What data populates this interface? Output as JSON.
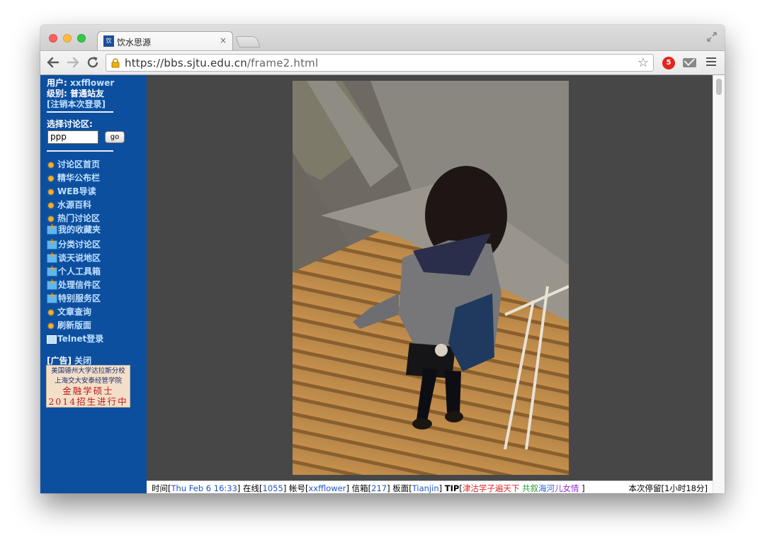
{
  "browser": {
    "tab_title": "饮水思源",
    "tab_favicon_text": "饮水",
    "tab_close": "×",
    "url_prefix": "https://",
    "url_host": "bbs.sjtu.edu.cn",
    "url_path": "/frame2.html",
    "ext_badge": "5"
  },
  "sidebar": {
    "user_label": "用户:",
    "user_value": "xxfflower",
    "level_label": "级别:",
    "level_value": "普通站友",
    "logout": "[注销本次登录]",
    "select_board_label": "选择讨论区:",
    "board_input_value": "ppp",
    "go_label": "go",
    "menu": [
      {
        "label": "讨论区首页",
        "icon": "gear-icon"
      },
      {
        "label": "精华公布栏",
        "icon": "gear-icon"
      },
      {
        "label": "WEB导读",
        "icon": "gear-icon"
      },
      {
        "label": "水源百科",
        "icon": "gear-icon"
      },
      {
        "label": "热门讨论区",
        "icon": "gear-icon"
      },
      {
        "label": "我的收藏夹",
        "icon": "folder-icon"
      },
      {
        "label": "分类讨论区",
        "icon": "folder-icon"
      },
      {
        "label": "谈天说地区",
        "icon": "folder-icon"
      },
      {
        "label": "个人工具箱",
        "icon": "folder-icon"
      },
      {
        "label": "处理信件区",
        "icon": "folder-icon"
      },
      {
        "label": "特别服务区",
        "icon": "folder-icon"
      },
      {
        "label": "文章查询",
        "icon": "gear-icon"
      },
      {
        "label": "刷新版面",
        "icon": "gear-icon"
      },
      {
        "label": "Telnet登录",
        "icon": "terminal-icon"
      }
    ],
    "ad_label": "[广告]",
    "ad_close": "关闭",
    "ad": {
      "line1": "美国德州大学达拉斯分校",
      "line2": "上海交大安泰经管学院",
      "line3": "金融学硕士",
      "line4": "2014招生进行中"
    }
  },
  "statusbar": {
    "time_label": "时间",
    "time_value": "Thu Feb 6 16:33",
    "online_label": "在线",
    "online_value": "1055",
    "account_label": "帐号",
    "account_value": "xxfflower",
    "mail_label": "信箱",
    "mail_value": "217",
    "board_label": "板面",
    "board_value": "Tianjin",
    "tip_label": "TIP",
    "tip_part1": "津沽学子遍天下",
    "tip_part2": "共叙",
    "tip_part3": "海河",
    "tip_part4": "儿女情",
    "stay_label": "本次停留",
    "stay_value": "1小时18分"
  }
}
